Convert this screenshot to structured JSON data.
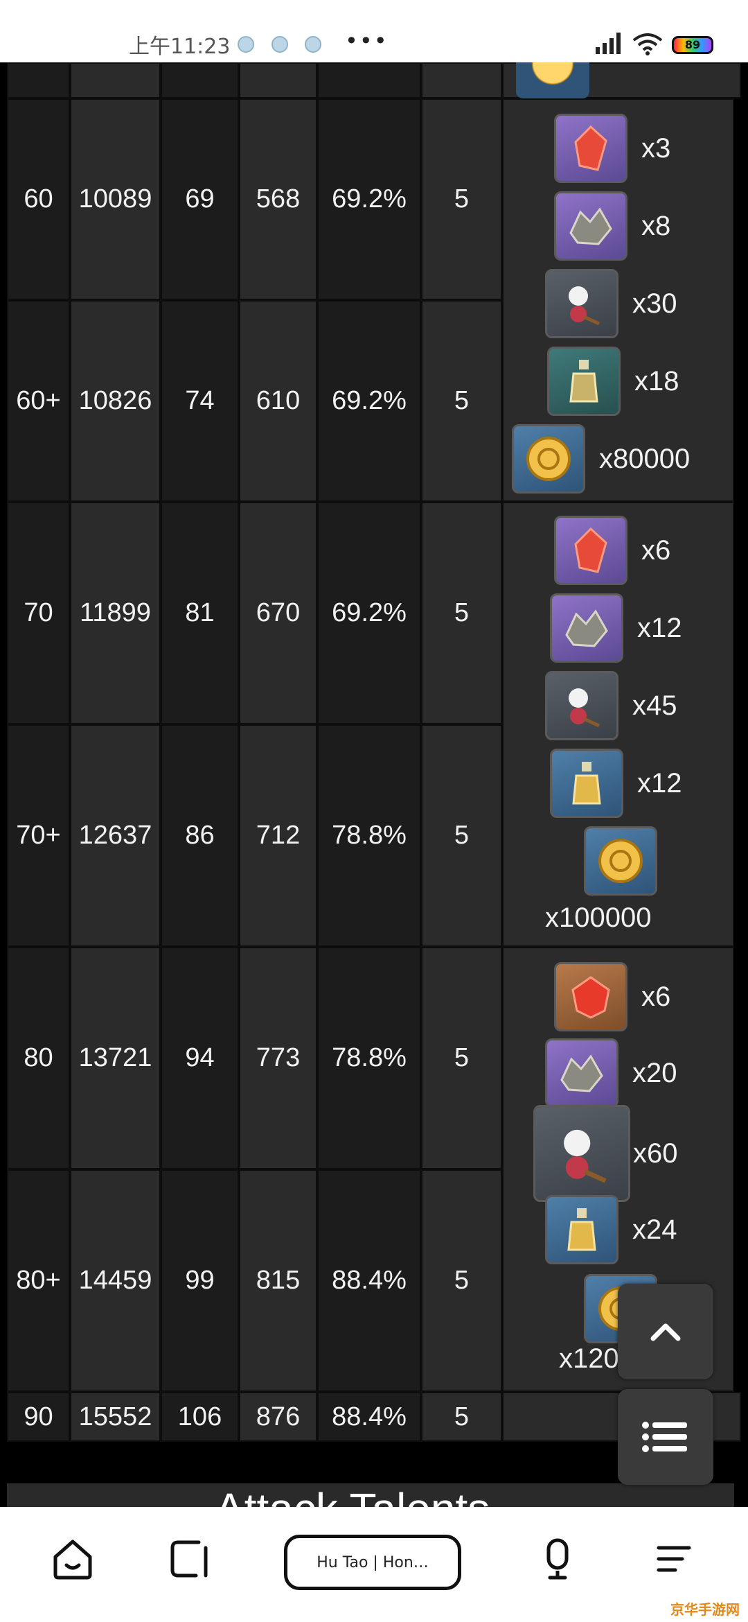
{
  "status_bar": {
    "time": "上午11:23",
    "more": "•••",
    "battery": "89"
  },
  "table": {
    "rows": [
      {
        "level": "60",
        "hp": "10089",
        "atk": "69",
        "def": "568",
        "bonus": "69.2%",
        "slots": "5"
      },
      {
        "level": "60+",
        "hp": "10826",
        "atk": "74",
        "def": "610",
        "bonus": "69.2%",
        "slots": "5"
      },
      {
        "level": "70",
        "hp": "11899",
        "atk": "81",
        "def": "670",
        "bonus": "69.2%",
        "slots": "5"
      },
      {
        "level": "70+",
        "hp": "12637",
        "atk": "86",
        "def": "712",
        "bonus": "78.8%",
        "slots": "5"
      },
      {
        "level": "80",
        "hp": "13721",
        "atk": "94",
        "def": "773",
        "bonus": "78.8%",
        "slots": "5"
      },
      {
        "level": "80+",
        "hp": "14459",
        "atk": "99",
        "def": "815",
        "bonus": "88.4%",
        "slots": "5"
      },
      {
        "level": "90",
        "hp": "15552",
        "atk": "106",
        "def": "876",
        "bonus": "88.4%",
        "slots": "5"
      }
    ],
    "materials": [
      {
        "items": [
          {
            "icon": "gem-icon",
            "count": "x3"
          },
          {
            "icon": "stone-icon",
            "count": "x8"
          },
          {
            "icon": "flower-icon",
            "count": "x30"
          },
          {
            "icon": "bottle-icon",
            "count": "x18"
          },
          {
            "icon": "mora-coin-icon",
            "count": "x80000"
          }
        ]
      },
      {
        "items": [
          {
            "icon": "gem-icon",
            "count": "x6"
          },
          {
            "icon": "stone-icon",
            "count": "x12"
          },
          {
            "icon": "flower-icon",
            "count": "x45"
          },
          {
            "icon": "bottle-icon",
            "count": "x12"
          },
          {
            "icon": "mora-coin-icon",
            "count": "x100000"
          }
        ]
      },
      {
        "items": [
          {
            "icon": "gem-icon",
            "count": "x6"
          },
          {
            "icon": "stone-icon",
            "count": "x20"
          },
          {
            "icon": "flower-icon",
            "count": "x60"
          },
          {
            "icon": "bottle-icon",
            "count": "x24"
          },
          {
            "icon": "mora-coin-icon",
            "count": "x120"
          }
        ]
      }
    ]
  },
  "section_heading": "Attack Talents",
  "browser": {
    "address": "Hu Tao | Hon…"
  },
  "watermark": "京华手游网"
}
